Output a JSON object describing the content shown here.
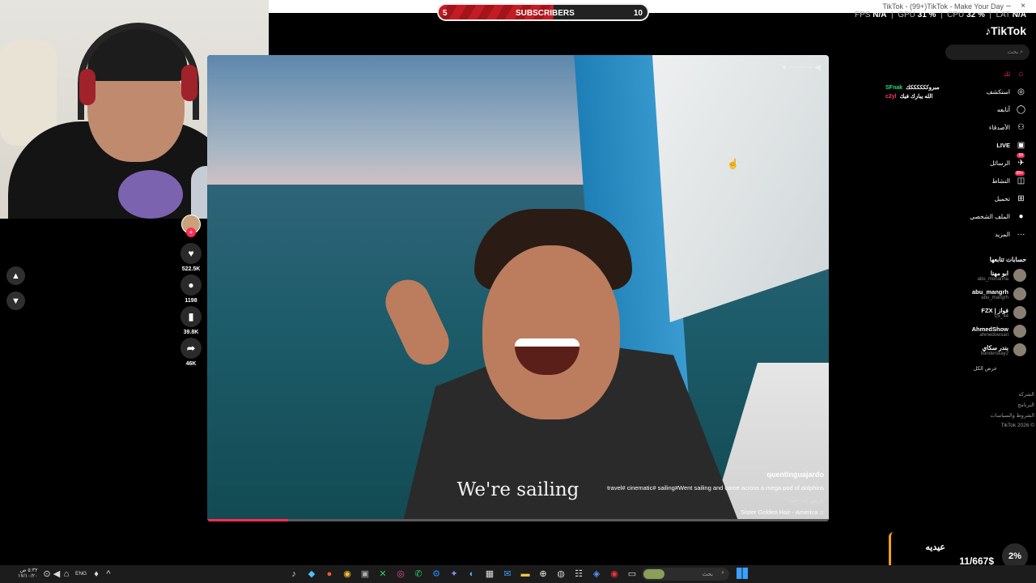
{
  "window": {
    "title": "TikTok - (99+)TikTok - Make Your Day"
  },
  "overlay": {
    "subscribers_label": "SUBSCRIBERS",
    "subscribers_start": "5",
    "subscribers_goal": "10",
    "subscribers_progress": 0.55,
    "stats": {
      "fps_label": "FPS",
      "fps_value": "N/A",
      "gpu_label": "GPU",
      "gpu_value": "31 %",
      "cpu_label": "CPU",
      "cpu_value": "32 %",
      "lat_label": "LAT",
      "lat_value": "N/A"
    }
  },
  "video": {
    "caption": "We're sailing",
    "author": "quentinguajardo",
    "description": "travel# cinematic# sailing#Went sailing and came across a mega pod of dolphins",
    "translate": "عرض الترجمة",
    "music": "Sister Golden Hair - America",
    "progress": 0.13
  },
  "actions": {
    "likes": "522.5K",
    "comments": "1198",
    "saves": "39.8K",
    "shares": "46K"
  },
  "sidebar": {
    "logo": "TikTok",
    "search_placeholder": "بحث",
    "nav": [
      {
        "label": "لك",
        "icon": "home-icon"
      },
      {
        "label": "استكشف",
        "icon": "compass-icon"
      },
      {
        "label": "أتابعه",
        "icon": "following-icon"
      },
      {
        "label": "الأصدقاء",
        "icon": "friends-icon"
      },
      {
        "label": "LIVE",
        "icon": "live-icon"
      },
      {
        "label": "الرسائل",
        "icon": "messages-icon",
        "badge": "99"
      },
      {
        "label": "النشاط",
        "icon": "activity-icon",
        "badge": "99+"
      },
      {
        "label": "تحميل",
        "icon": "upload-icon"
      },
      {
        "label": "الملف الشخصي",
        "icon": "profile-icon"
      },
      {
        "label": "المزيد",
        "icon": "more-icon"
      }
    ],
    "following_header": "حسابات تتابعها",
    "accounts": [
      {
        "name": "ابو مهنا",
        "handle": "abu_mohanna"
      },
      {
        "name": "abu_mangrh",
        "handle": "abu_mangrh"
      },
      {
        "name": "FZX | فواز",
        "handle": "fzx_44"
      },
      {
        "name": "AhmedShow",
        "handle": "ahmedowsari"
      },
      {
        "name": "بندر سكاي",
        "handle": "banderskay2"
      }
    ],
    "see_all": "عرض الكل",
    "footer": [
      "الشركة",
      "البرنامج",
      "الشروط والسياسات",
      "TikTok 2026 ©"
    ]
  },
  "chat": [
    {
      "user": "SFnak",
      "message": "مبروككككككك"
    },
    {
      "user": "c2yl",
      "message": "الله يبارك فيك"
    }
  ],
  "widget": {
    "title": "عيديه",
    "value": "11/667$",
    "percent": "2%"
  },
  "taskbar": {
    "search_placeholder": "بحث",
    "language": "ENG",
    "clock_time": "٥:٣٢ ص",
    "clock_date": "١٧/١٠/٢٠"
  }
}
